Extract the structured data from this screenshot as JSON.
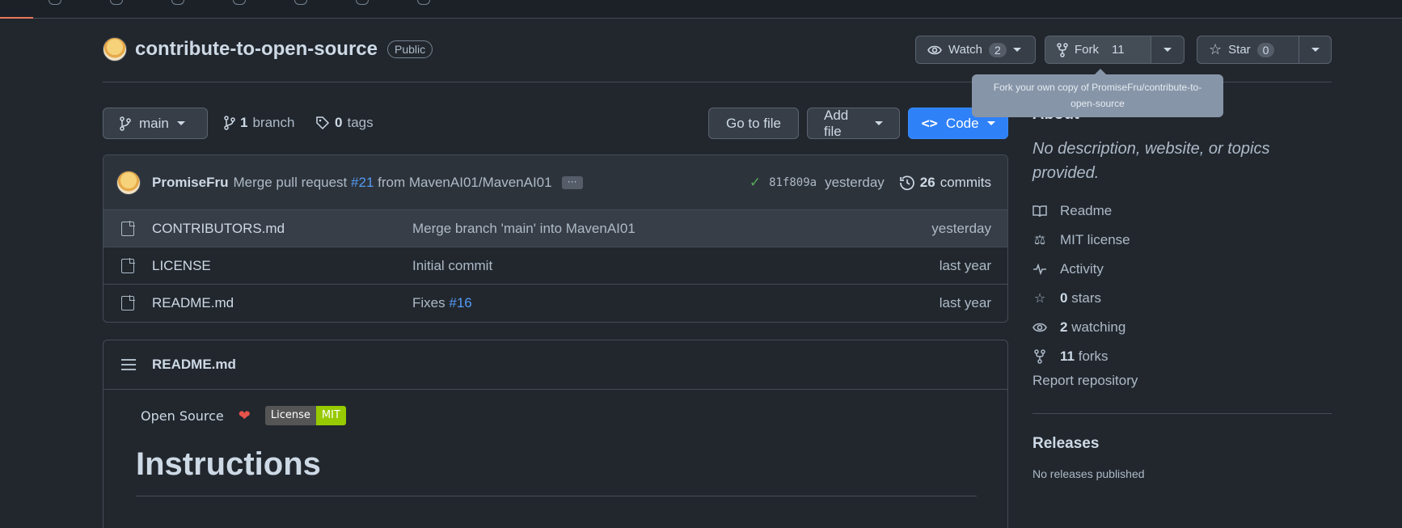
{
  "repo": {
    "name": "contribute-to-open-source",
    "visibility": "Public"
  },
  "actions": {
    "watch_label": "Watch",
    "watch_count": "2",
    "fork_label": "Fork",
    "fork_count": "11",
    "star_label": "Star",
    "star_count": "0"
  },
  "tooltip": "Fork your own copy of PromiseFru/contribute-to-open-source",
  "branch": {
    "current": "main",
    "branch_count": "1",
    "branch_word": "branch",
    "tag_count": "0",
    "tag_word": "tags",
    "goto_file": "Go to file",
    "add_file": "Add file",
    "code": "Code"
  },
  "latest_commit": {
    "author": "PromiseFru",
    "message_pre": "Merge pull request",
    "pr": "#21",
    "message_post": "from MavenAI01/MavenAI01",
    "ellipsis": "···",
    "sha": "81f809a",
    "time": "yesterday",
    "commit_count": "26",
    "commit_word": "commits"
  },
  "files": [
    {
      "name": "CONTRIBUTORS.md",
      "message": "Merge branch 'main' into MavenAI01",
      "link": "",
      "time": "yesterday"
    },
    {
      "name": "LICENSE",
      "message": "Initial commit",
      "link": "",
      "time": "last year"
    },
    {
      "name": "README.md",
      "message": "Fixes",
      "link": "#16",
      "time": "last year"
    }
  ],
  "readme": {
    "title": "README.md",
    "open_source": "Open Source",
    "heart": "❤",
    "license_left": "License",
    "license_right": "MIT",
    "heading": "Instructions"
  },
  "about": {
    "title": "About",
    "description": "No description, website, or topics provided.",
    "items": [
      {
        "icon": "book-icon",
        "count": "",
        "label": "Readme"
      },
      {
        "icon": "law-icon",
        "count": "",
        "label": "MIT license"
      },
      {
        "icon": "pulse-icon",
        "count": "",
        "label": "Activity"
      },
      {
        "icon": "star-icon",
        "count": "0",
        "label": "stars"
      },
      {
        "icon": "eye-icon",
        "count": "2",
        "label": "watching"
      },
      {
        "icon": "fork-icon",
        "count": "11",
        "label": "forks"
      }
    ],
    "report": "Report repository"
  },
  "releases": {
    "title": "Releases",
    "empty": "No releases published"
  },
  "colors": {
    "background": "#22272e",
    "link": "#539bf5",
    "code_button": "#2f81f7",
    "tab_active": "#ec775c"
  }
}
